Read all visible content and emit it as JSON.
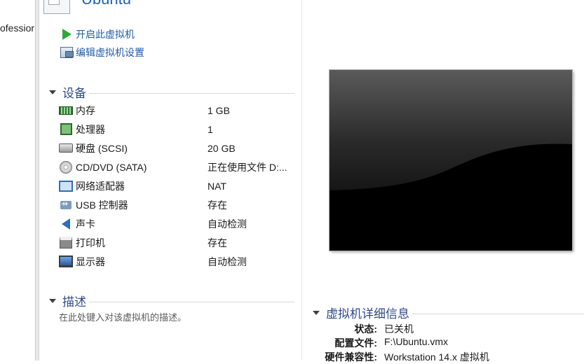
{
  "library": {
    "fragment": "ofessior"
  },
  "vm": {
    "name": "Ubuntu"
  },
  "commands": {
    "power_on": "开启此虚拟机",
    "edit_settings": "编辑虚拟机设置"
  },
  "devices": {
    "heading": "设备",
    "items": [
      {
        "icon": "memory-icon",
        "name": "内存",
        "value": "1 GB"
      },
      {
        "icon": "processor-icon",
        "name": "处理器",
        "value": "1"
      },
      {
        "icon": "hard-disk-icon",
        "name": "硬盘 (SCSI)",
        "value": "20 GB"
      },
      {
        "icon": "cd-dvd-icon",
        "name": "CD/DVD (SATA)",
        "value": "正在使用文件 D:..."
      },
      {
        "icon": "network-adapter-icon",
        "name": "网络适配器",
        "value": "NAT"
      },
      {
        "icon": "usb-controller-icon",
        "name": "USB 控制器",
        "value": "存在"
      },
      {
        "icon": "sound-card-icon",
        "name": "声卡",
        "value": "自动检测"
      },
      {
        "icon": "printer-icon",
        "name": "打印机",
        "value": "存在"
      },
      {
        "icon": "display-icon",
        "name": "显示器",
        "value": "自动检测"
      }
    ]
  },
  "description": {
    "heading": "描述",
    "placeholder": "在此处键入对该虚拟机的描述。"
  },
  "details": {
    "heading": "虚拟机详细信息",
    "rows": [
      {
        "label": "状态:",
        "value": "已关机"
      },
      {
        "label": "配置文件:",
        "value": "F:\\Ubuntu.vmx"
      },
      {
        "label": "硬件兼容性:",
        "value": "Workstation 14.x 虚拟机"
      }
    ]
  }
}
